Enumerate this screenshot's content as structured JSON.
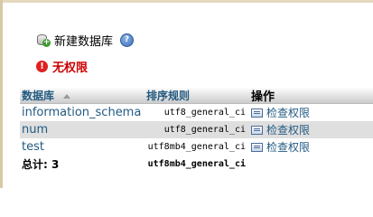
{
  "create_db": {
    "label": "新建数据库",
    "help_icon": "help-icon",
    "db_icon": "database-add-icon"
  },
  "privileges": {
    "message": "无权限",
    "icon": "error-icon"
  },
  "table": {
    "headers": {
      "name": "数据库",
      "collation": "排序规则",
      "action": "操作"
    },
    "rows": [
      {
        "name": "information_schema",
        "collation": "utf8_general_ci",
        "action": "检查权限"
      },
      {
        "name": "num",
        "collation": "utf8_general_ci",
        "action": "检查权限"
      },
      {
        "name": "test",
        "collation": "utf8mb4_general_ci",
        "action": "检查权限"
      }
    ],
    "total": {
      "label": "总计: 3",
      "collation": "utf8mb4_general_ci"
    }
  }
}
